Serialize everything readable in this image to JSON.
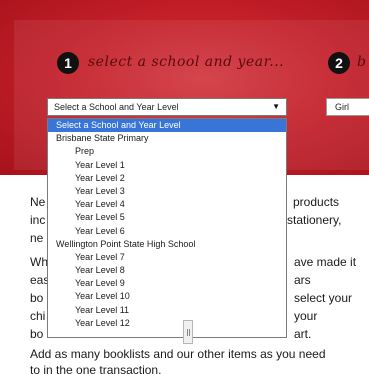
{
  "steps": [
    {
      "number": "1",
      "label": "select a school and year..."
    },
    {
      "number": "2",
      "label": "b"
    }
  ],
  "school_select": {
    "value": "Select a School and Year Level",
    "arrow_icon": "dropdown-arrow-icon"
  },
  "gender_select": {
    "value": "Girl"
  },
  "dropdown": {
    "options": [
      {
        "label": "Select a School and Year Level",
        "kind": "selected"
      },
      {
        "label": "Brisbane State Primary",
        "kind": "group"
      },
      {
        "label": "Prep",
        "kind": "option"
      },
      {
        "label": "Year Level 1",
        "kind": "option"
      },
      {
        "label": "Year Level 2",
        "kind": "option"
      },
      {
        "label": "Year Level 3",
        "kind": "option"
      },
      {
        "label": "Year Level 4",
        "kind": "option"
      },
      {
        "label": "Year Level 5",
        "kind": "option"
      },
      {
        "label": "Year Level 6",
        "kind": "option"
      },
      {
        "label": "Wellington Point State High School",
        "kind": "group"
      },
      {
        "label": "Year Level 7",
        "kind": "option"
      },
      {
        "label": "Year Level 8",
        "kind": "option"
      },
      {
        "label": "Year Level 9",
        "kind": "option"
      },
      {
        "label": "Year Level 10",
        "kind": "option"
      },
      {
        "label": "Year Level 11",
        "kind": "option"
      },
      {
        "label": "Year Level 12",
        "kind": "option"
      }
    ]
  },
  "paragraph_fragments": {
    "p1_line1_left": "Ne",
    "p1_line1_right": "products",
    "p1_line2_left": "inc",
    "p1_line2_right": "stationery,",
    "p1_line3_left": "ne",
    "p2_line1_left": "Wh",
    "p2_line1_right": "ave made it",
    "p2_line2_left": "eas",
    "p2_line2_right": "ars",
    "p2_line3_left": "bo",
    "p2_line3_right": "select your",
    "p2_line4_left": "chi",
    "p2_line4_right": "your",
    "p2_line5_left": "bo",
    "p2_line5_right": "art.",
    "p3_line1": "Add as many booklists and our other items as you need",
    "p3_line2": "to in the one transaction."
  },
  "colors": {
    "banner": "#c4202a",
    "selection": "#3875d7",
    "step_circle": "#111111"
  }
}
